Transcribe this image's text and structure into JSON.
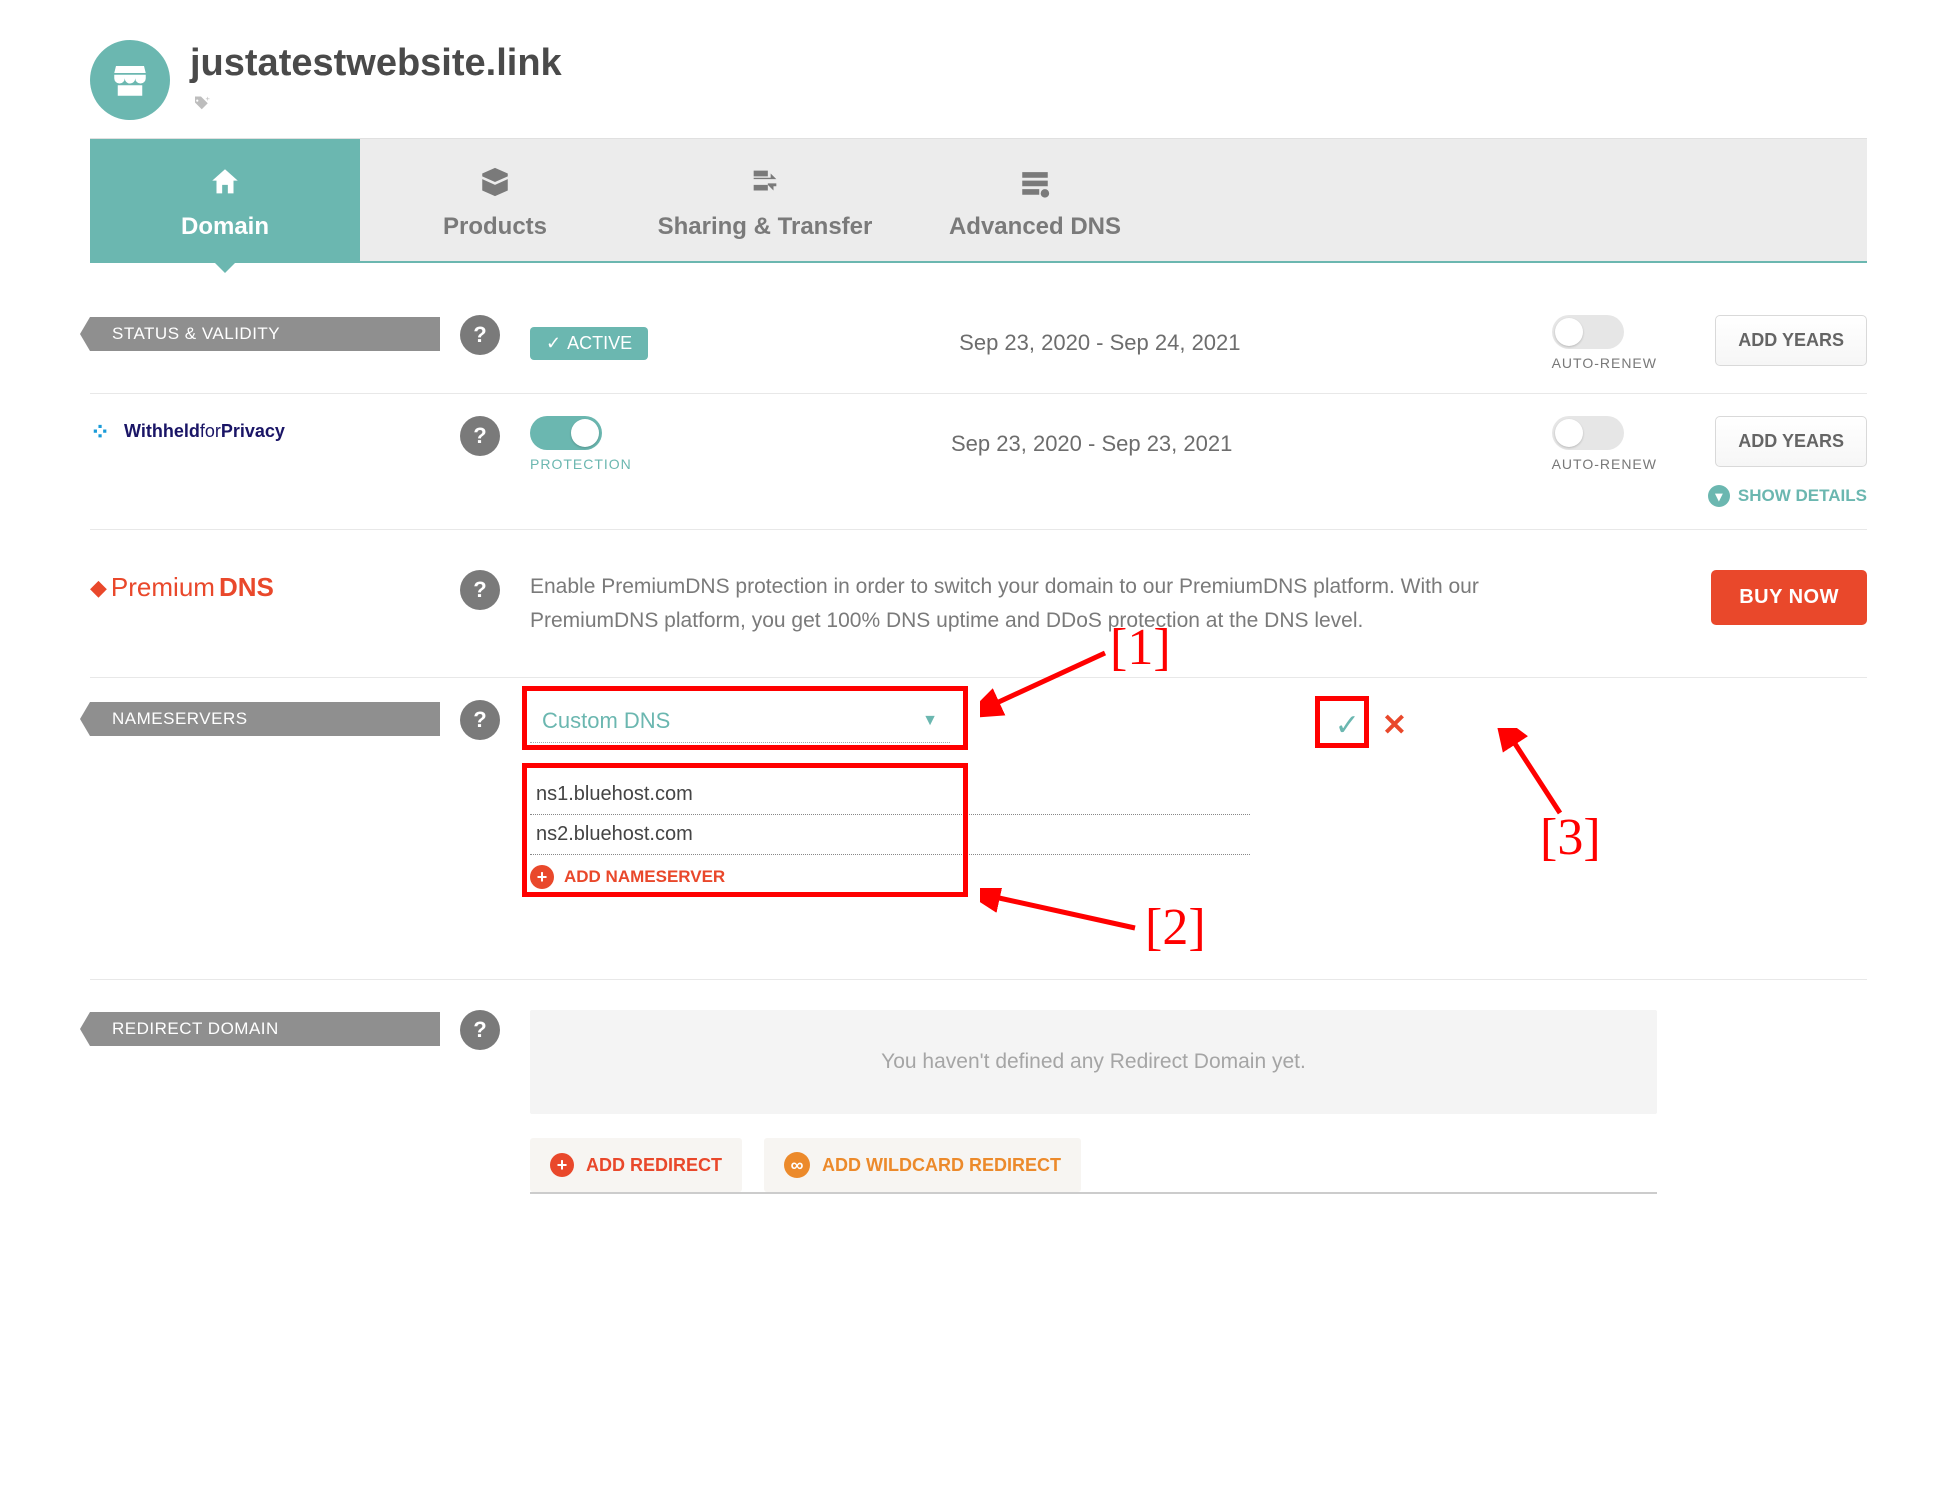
{
  "header": {
    "domain_name": "justatestwebsite.link"
  },
  "tabs": {
    "domain": "Domain",
    "products": "Products",
    "sharing": "Sharing & Transfer",
    "advanced": "Advanced DNS"
  },
  "status_row": {
    "label": "STATUS & VALIDITY",
    "badge": "ACTIVE",
    "dates": "Sep 23, 2020 - Sep 24, 2021",
    "auto_renew": "AUTO-RENEW",
    "add_years": "ADD YEARS"
  },
  "privacy_row": {
    "logo_a": "Withheld",
    "logo_b": "for",
    "logo_c": "Privacy",
    "protection": "PROTECTION",
    "dates": "Sep 23, 2020 - Sep 23, 2021",
    "auto_renew": "AUTO-RENEW",
    "add_years": "ADD YEARS",
    "show_details": "SHOW DETAILS"
  },
  "premium_row": {
    "logo_a": "Premium",
    "logo_b": "DNS",
    "desc": "Enable PremiumDNS protection in order to switch your domain to our PremiumDNS platform. With our PremiumDNS platform, you get 100% DNS uptime and DDoS protection at the DNS level.",
    "buy": "BUY NOW"
  },
  "nameservers": {
    "label": "NAMESERVERS",
    "select_value": "Custom DNS",
    "ns1": "ns1.bluehost.com",
    "ns2": "ns2.bluehost.com",
    "add": "ADD NAMESERVER"
  },
  "redirect": {
    "label": "REDIRECT DOMAIN",
    "empty": "You haven't defined any Redirect Domain yet.",
    "add_redirect": "ADD REDIRECT",
    "add_wildcard": "ADD WILDCARD REDIRECT"
  },
  "annotations": {
    "a1": "[1]",
    "a2": "[2]",
    "a3": "[3]"
  }
}
